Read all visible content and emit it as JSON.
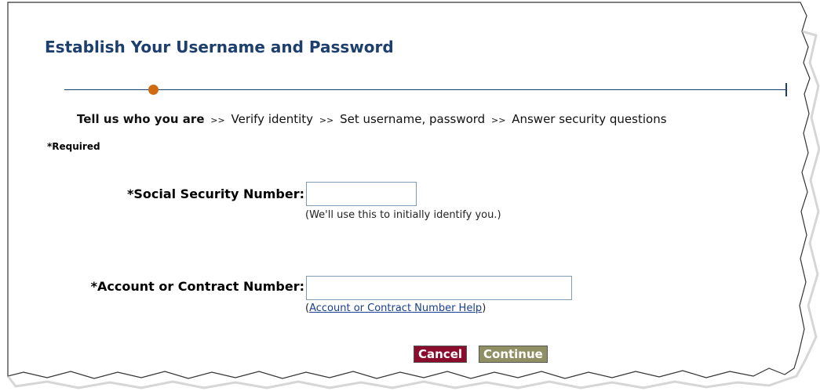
{
  "page": {
    "title": "Establish Your Username and Password",
    "required_note": "*Required"
  },
  "progress": {
    "current_step": "Tell us who you are",
    "separator": ">>",
    "steps": [
      "Tell us who you are",
      "Verify identity",
      "Set username, password",
      "Answer security questions"
    ],
    "accent_color": "#d06b12",
    "line_color": "#1c3f6e"
  },
  "form": {
    "ssn": {
      "label": "*Social Security Number:",
      "value": "",
      "hint": "(We'll use this to initially identify you.)"
    },
    "account": {
      "label": "*Account or Contract Number:",
      "value": "",
      "hint_open": "(",
      "help_link": "Account or Contract Number Help",
      "hint_close": ")"
    }
  },
  "buttons": {
    "cancel": "Cancel",
    "continue": "Continue"
  }
}
